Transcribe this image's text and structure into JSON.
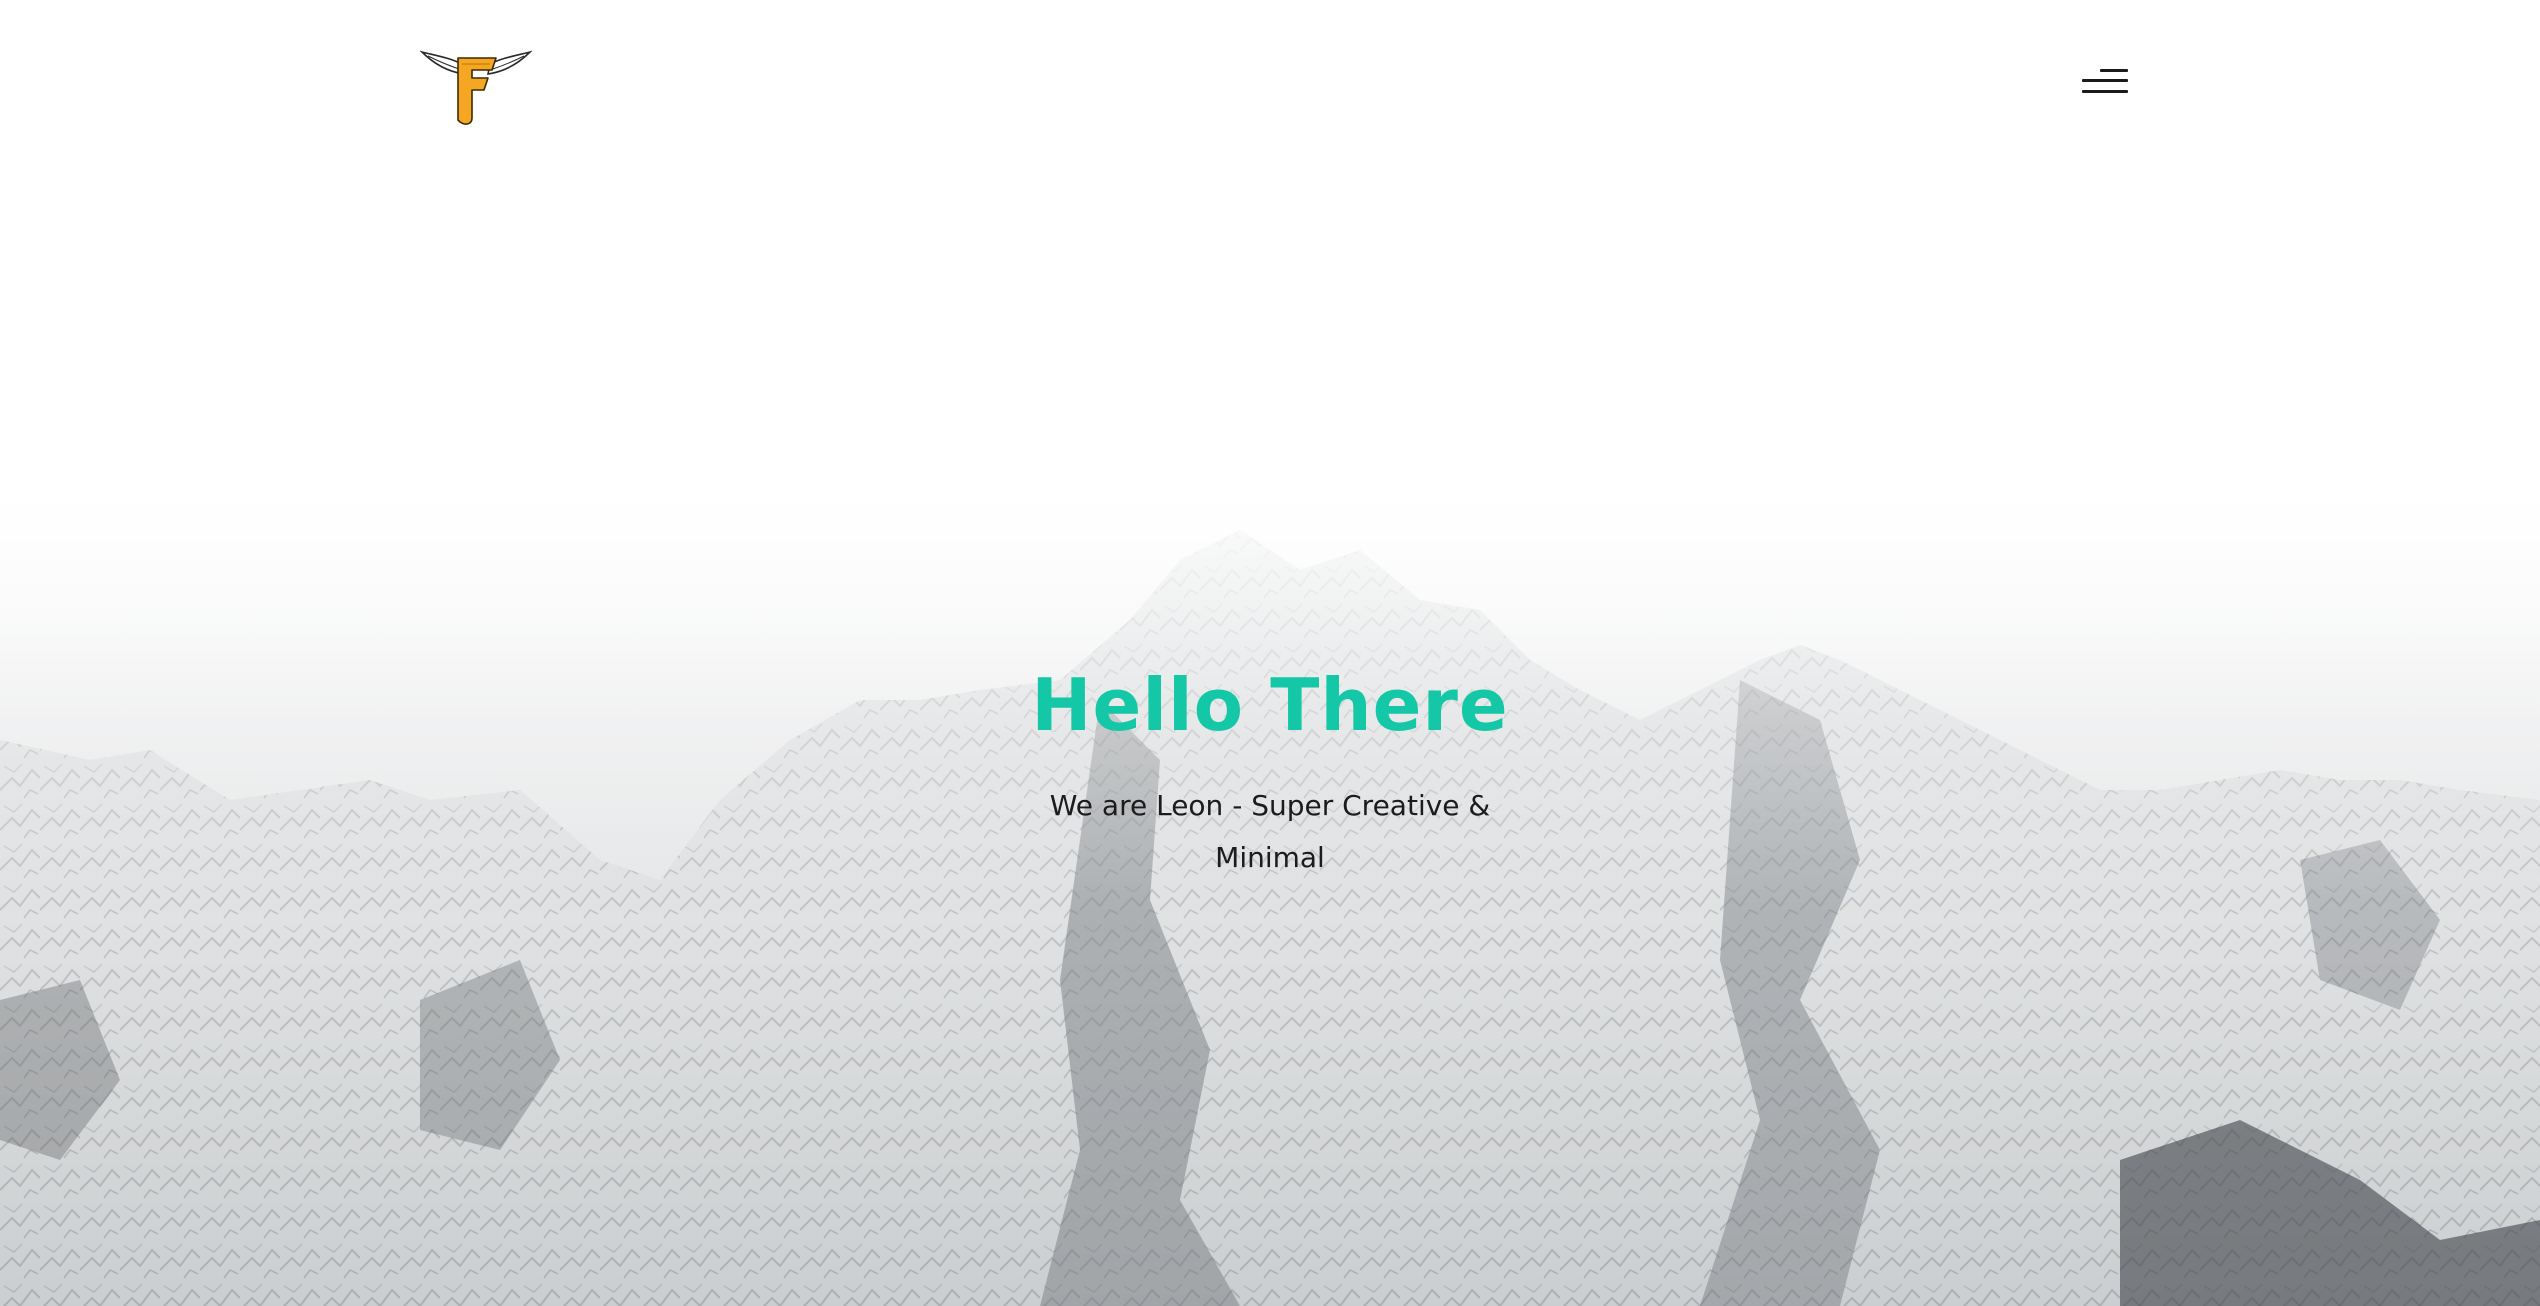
{
  "header": {
    "logo_alt": "winged F logo",
    "menu_icon": "hamburger-menu-icon"
  },
  "hero": {
    "title": "Hello There",
    "subtitle": "We are Leon - Super Creative & Minimal",
    "background": "snowy-mountain-photo"
  },
  "colors": {
    "accent": "#14c7a6",
    "logo_gold": "#f5a623",
    "text": "#1c1c1c",
    "background": "#ffffff"
  }
}
